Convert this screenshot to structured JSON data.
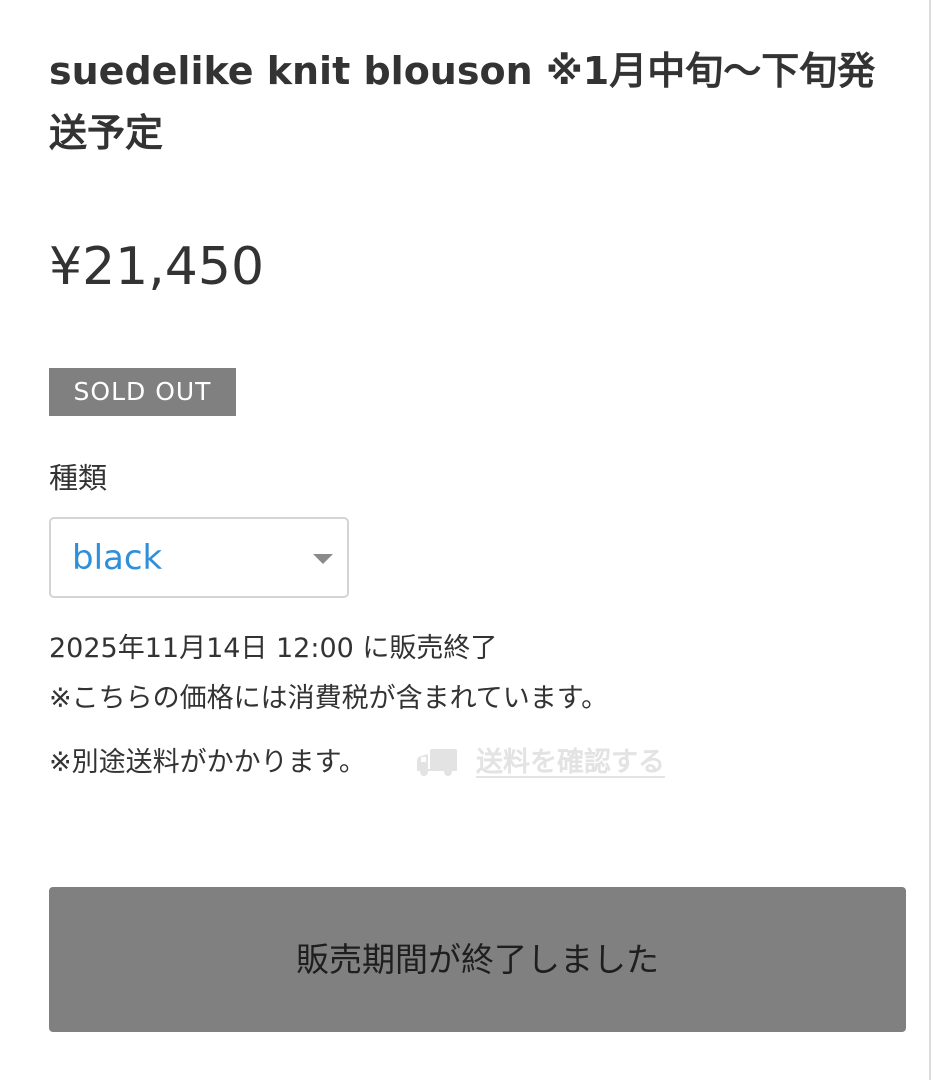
{
  "product": {
    "title": "suedelike knit blouson ※1月中旬〜下旬発送予定",
    "price": "¥21,450",
    "sold_out_label": "SOLD OUT"
  },
  "variant": {
    "label": "種類",
    "selected": "black",
    "icon": "chevron-down-icon"
  },
  "notes": {
    "sale_end": "2025年11月14日 12:00 に販売終了",
    "tax": "※こちらの価格には消費税が含まれています。",
    "shipping": "※別途送料がかかります。",
    "shipping_icon": "truck-icon",
    "shipping_link": "送料を確認する"
  },
  "purchase": {
    "button_label": "販売期間が終了しました"
  },
  "colors": {
    "badge": "#808080",
    "button": "#808080",
    "select_text": "#2f8fd8",
    "link_disabled": "#e3e3e3"
  }
}
